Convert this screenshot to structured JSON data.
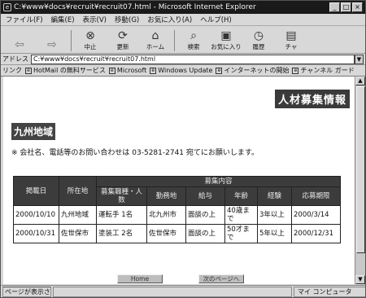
{
  "window": {
    "title": "C:¥www¥docs¥recruit¥recruit07.html - Microsoft Internet Explorer",
    "min_label": "_",
    "max_label": "□",
    "close_label": "×"
  },
  "menu": [
    "ファイル(F)",
    "編集(E)",
    "表示(V)",
    "移動(G)",
    "お気に入り(A)",
    "ヘルプ(H)"
  ],
  "toolbar": [
    {
      "label": "",
      "icon": "back-icon",
      "glyph": "⇦"
    },
    {
      "label": "",
      "icon": "forward-icon",
      "glyph": "⇨"
    },
    {
      "label": "中止",
      "icon": "stop-icon",
      "glyph": "⊗"
    },
    {
      "label": "更新",
      "icon": "refresh-icon",
      "glyph": "⟳"
    },
    {
      "label": "ホーム",
      "icon": "home-icon",
      "glyph": "⌂"
    },
    {
      "label": "検索",
      "icon": "search-icon",
      "glyph": "⌕"
    },
    {
      "label": "お気に入り",
      "icon": "favorites-icon",
      "glyph": "▣"
    },
    {
      "label": "履歴",
      "icon": "history-icon",
      "glyph": "◷"
    },
    {
      "label": "チャ",
      "icon": "channels-icon",
      "glyph": "▤"
    }
  ],
  "address": {
    "label": "アドレス",
    "value": "C:¥www¥docs¥recruit¥recruit07.html"
  },
  "links": {
    "label": "リンク",
    "items": [
      "HotMail の無料サービス",
      "Microsoft",
      "Windows Update",
      "インターネットの開始",
      "チャンネル ガード"
    ]
  },
  "page": {
    "title": "人材募集情報",
    "region": "九州地域",
    "notice": "※ 会社名、電話等のお問い合わせは 03-5281-2741 宛てにお願いします。"
  },
  "table": {
    "headers": {
      "date": "掲載日",
      "location": "所在地",
      "group": "募集内容",
      "job": "募集職種・人数",
      "workplace": "勤務地",
      "salary": "給与",
      "age": "年齢",
      "experience": "経験",
      "deadline": "応募期限"
    },
    "rows": [
      {
        "date": "2000/10/10",
        "location": "九州地域",
        "job": "運転手 1名",
        "workplace": "北九州市",
        "salary": "面談の上",
        "age": "40歳まで",
        "experience": "3年以上",
        "deadline": "2000/3/14"
      },
      {
        "date": "2000/10/31",
        "location": "佐世保市",
        "job": "塗装工 2名",
        "workplace": "佐世保市",
        "salary": "面談の上",
        "age": "50才まで",
        "experience": "5年以上",
        "deadline": "2000/12/31"
      }
    ]
  },
  "nav": {
    "prev": "Home",
    "next": "次のページへ"
  },
  "status": {
    "text": "ページが表示され",
    "zone": "マイ コンピュータ"
  }
}
